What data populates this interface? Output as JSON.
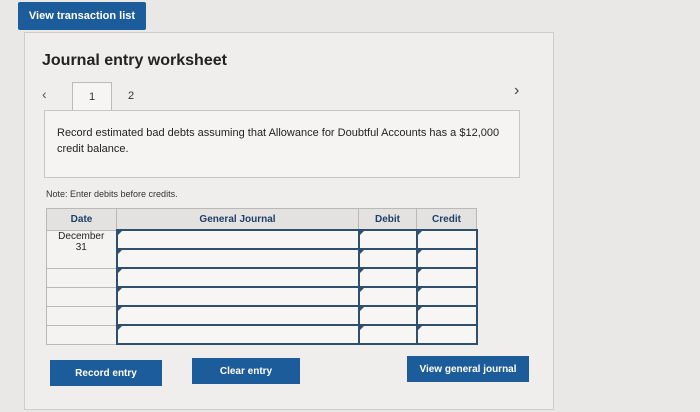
{
  "top_button": "View transaction list",
  "worksheet": {
    "title": "Journal entry worksheet",
    "tabs": [
      "1",
      "2"
    ],
    "prev_icon": "‹",
    "next_icon": "›",
    "instruction": "Record estimated bad debts assuming that Allowance for Doubtful Accounts has a $12,000 credit balance.",
    "note": "Note: Enter debits before credits."
  },
  "table": {
    "headers": {
      "date": "Date",
      "journal": "General Journal",
      "debit": "Debit",
      "credit": "Credit"
    },
    "date_month": "December",
    "date_day": "31"
  },
  "buttons": {
    "record": "Record entry",
    "clear": "Clear entry",
    "view_journal": "View general journal"
  }
}
